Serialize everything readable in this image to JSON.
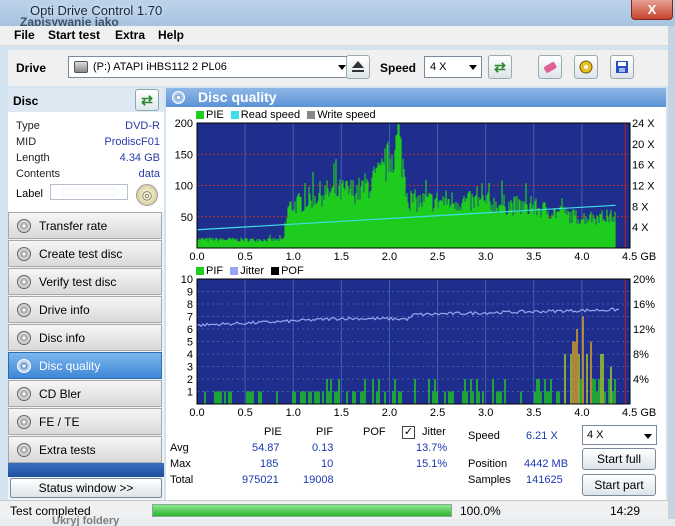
{
  "window": {
    "title": "Opti Drive Control 1.70",
    "subtitle": "Zapisywanie jako",
    "close_label": "X"
  },
  "menu": [
    "File",
    "Start test",
    "Extra",
    "Help"
  ],
  "toolbar": {
    "drive_label": "Drive",
    "drive_value": "(P:)   ATAPI iHBS112   2 PL06",
    "speed_label": "Speed",
    "speed_value": "4 X"
  },
  "disc": {
    "header": "Disc",
    "rows": [
      {
        "key": "Type",
        "value": "DVD-R"
      },
      {
        "key": "MID",
        "value": "ProdiscF01"
      },
      {
        "key": "Length",
        "value": "4.34 GB"
      },
      {
        "key": "Contents",
        "value": "data"
      }
    ],
    "label_key": "Label"
  },
  "nav": [
    {
      "label": "Transfer rate",
      "active": false
    },
    {
      "label": "Create test disc",
      "active": false
    },
    {
      "label": "Verify test disc",
      "active": false
    },
    {
      "label": "Drive info",
      "active": false
    },
    {
      "label": "Disc info",
      "active": false
    },
    {
      "label": "Disc quality",
      "active": true
    },
    {
      "label": "CD Bler",
      "active": false
    },
    {
      "label": "FE / TE",
      "active": false
    },
    {
      "label": "Extra tests",
      "active": false
    }
  ],
  "status_window_label": "Status window >>",
  "panel_title": "Disc quality",
  "colors": {
    "pie": "#1fcc1f",
    "read_speed": "#3de0e8",
    "write_speed": "#888888",
    "pif": "#1fcc1f",
    "jitter": "#9aa6f0",
    "pof": "#000000",
    "plot_bg": "#1f2e8c",
    "grid": "#3f5fb0"
  },
  "chart_data": [
    {
      "type": "area",
      "legend": [
        "PIE",
        "Read speed",
        "Write speed"
      ],
      "x_ticks": [
        "0.0",
        "0.5",
        "1.0",
        "1.5",
        "2.0",
        "2.5",
        "3.0",
        "3.5",
        "4.0",
        "4.5 GB"
      ],
      "y_ticks_left": [
        "200",
        "150",
        "100",
        "50"
      ],
      "y_ticks_right": [
        "24 X",
        "20 X",
        "16 X",
        "12 X",
        "8 X",
        "4 X"
      ],
      "xlim": [
        0,
        4.5
      ],
      "ylim": [
        0,
        200
      ],
      "pie_profile": {
        "x": [
          0,
          0.9,
          0.95,
          1.3,
          1.7,
          1.9,
          2.1,
          2.2,
          2.3,
          2.6,
          3.0,
          3.5,
          4.0,
          4.35
        ],
        "y": [
          15,
          14,
          70,
          95,
          100,
          125,
          185,
          85,
          80,
          82,
          78,
          70,
          52,
          55
        ]
      },
      "read_speed": {
        "x": [
          0,
          4.35
        ],
        "y": [
          3.5,
          8.2
        ]
      }
    },
    {
      "type": "bar",
      "legend": [
        "PIF",
        "Jitter",
        "POF"
      ],
      "x_ticks": [
        "0.0",
        "0.5",
        "1.0",
        "1.5",
        "2.0",
        "2.5",
        "3.0",
        "3.5",
        "4.0",
        "4.5 GB"
      ],
      "y_ticks_left": [
        "10",
        "9",
        "8",
        "7",
        "6",
        "5",
        "4",
        "3",
        "2",
        "1"
      ],
      "y_ticks_right": [
        "20%",
        "16%",
        "12%",
        "8%",
        "4%"
      ],
      "xlim": [
        0,
        4.5
      ],
      "ylim": [
        0,
        10
      ],
      "pif_profile": {
        "x": [
          0,
          1.0,
          1.5,
          2.0,
          2.5,
          3.0,
          3.5,
          3.8,
          3.95,
          4.0,
          4.1,
          4.35
        ],
        "y": [
          1,
          1,
          2,
          3,
          2,
          2,
          2,
          4,
          6,
          10,
          5,
          4
        ]
      },
      "jitter_percent": {
        "x": [
          0,
          0.9,
          1.5,
          2.2,
          2.25,
          3.0,
          4.4
        ],
        "y": [
          12.6,
          13.2,
          13.7,
          13.6,
          14.3,
          14.6,
          15.1
        ]
      }
    }
  ],
  "stats": {
    "headers": {
      "pie": "PIE",
      "pif": "PIF",
      "pof": "POF",
      "jitter": "Jitter"
    },
    "rows": [
      {
        "label": "Avg",
        "pie": "54.87",
        "pif": "0.13",
        "jitter": "13.7%"
      },
      {
        "label": "Max",
        "pie": "185",
        "pif": "10",
        "jitter": "15.1%"
      },
      {
        "label": "Total",
        "pie": "975021",
        "pif": "19008"
      }
    ],
    "speed_label": "Speed",
    "speed_value": "6.21 X",
    "position_label": "Position",
    "position_value": "4442 MB",
    "samples_label": "Samples",
    "samples_value": "141625",
    "speed_select": "4 X",
    "start_full": "Start full",
    "start_part": "Start part"
  },
  "statusbar": {
    "text": "Test completed",
    "progress": 100,
    "progress_text": "100.0%",
    "time": "14:29",
    "under_text": "Ukryj foldery"
  }
}
